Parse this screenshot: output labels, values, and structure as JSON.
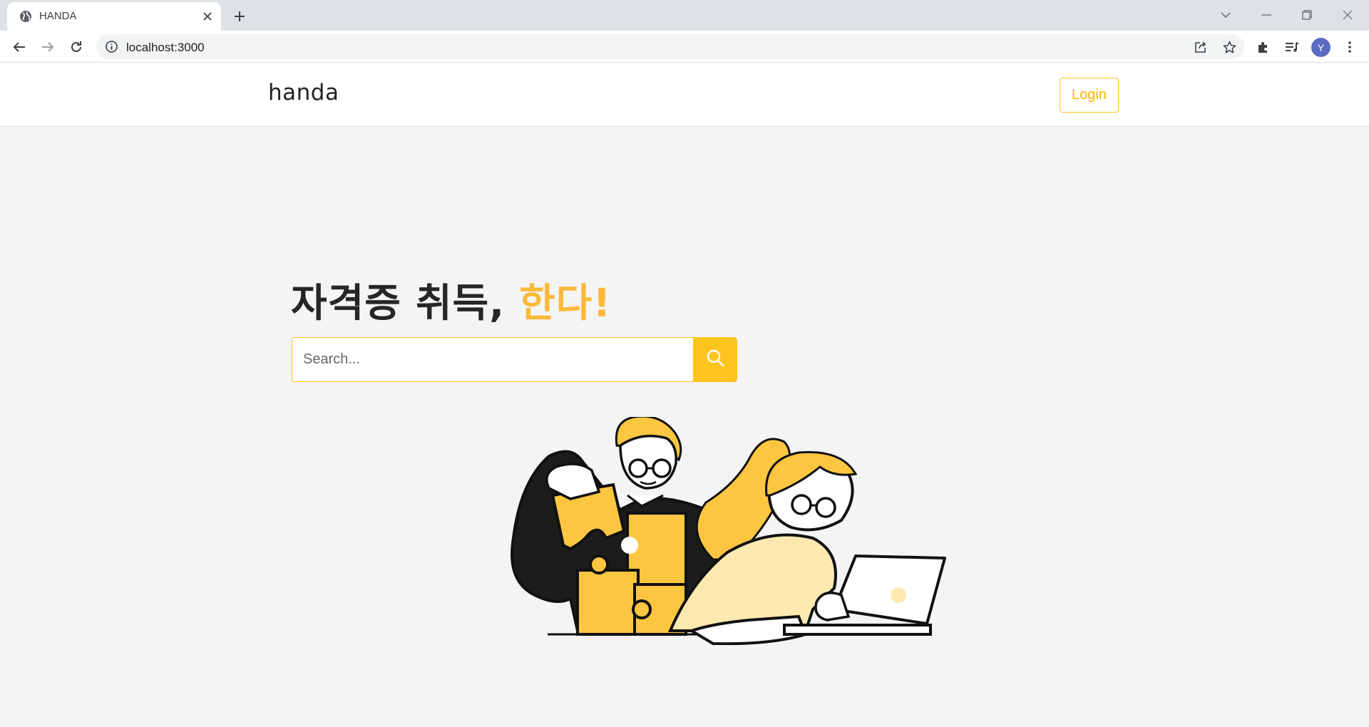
{
  "browser": {
    "tab_title": "HANDA",
    "url": "localhost:3000",
    "profile_initial": "Y"
  },
  "header": {
    "brand": "handa",
    "login_label": "Login"
  },
  "hero": {
    "title_main": "자격증 취득, ",
    "title_accent": "한다!"
  },
  "search": {
    "placeholder": "Search..."
  },
  "colors": {
    "accent": "#fdc31f",
    "accent_text": "#fbb93a",
    "background": "#f4f4f4"
  }
}
